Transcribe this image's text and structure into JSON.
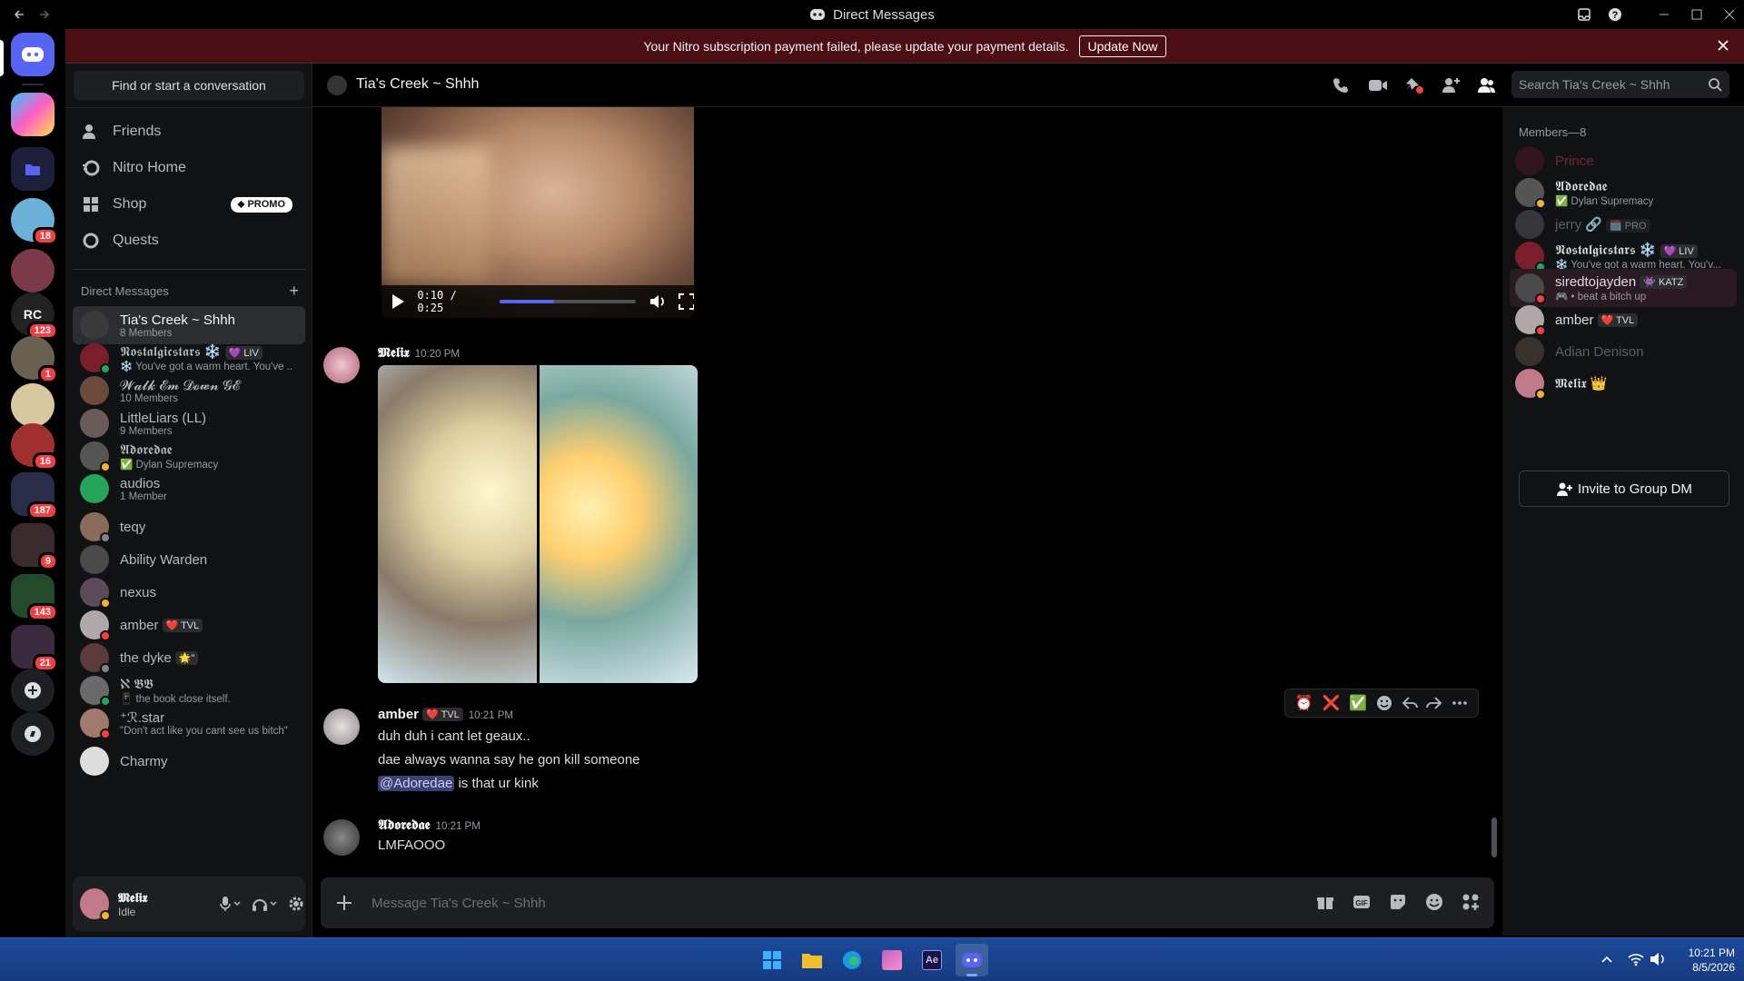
{
  "window": {
    "title": "Direct Messages"
  },
  "banner": {
    "text": "Your Nitro subscription payment failed, please update your payment details.",
    "button": "Update Now"
  },
  "rail": {
    "badges": [
      "18",
      "123",
      "1",
      "16",
      "187",
      "9",
      "143",
      "21"
    ],
    "logo_text": "RC"
  },
  "sidebar": {
    "find_placeholder": "Find or start a conversation",
    "nav": [
      {
        "label": "Friends",
        "icon": "friends-icon"
      },
      {
        "label": "Nitro Home",
        "icon": "nitro-icon"
      },
      {
        "label": "Shop",
        "icon": "shop-icon",
        "badge": "PROMO"
      },
      {
        "label": "Quests",
        "icon": "quests-icon"
      }
    ],
    "dm_header": "Direct Messages",
    "dms": [
      {
        "name": "Tia's Creek ~ Shhh",
        "sub": "8 Members",
        "color": "#3a3a3a",
        "status": ""
      },
      {
        "name": "𝕹𝖔𝖘𝖙𝖆𝖑𝖌𝖎𝖈𝖘𝖙𝖆𝖗𝖘 ❄️",
        "tag": "💜 LIV",
        "sub": "❄️ You've got a warm heart. You've ...",
        "color": "#7a1e2a",
        "status": "#23a55a"
      },
      {
        "name": "𝓦𝓪𝓵𝓴 𝓔𝓶 𝓓𝓸𝔀𝓷 𝓖𝓔",
        "sub": "10 Members",
        "color": "#6b4a3a",
        "status": ""
      },
      {
        "name": "LittleLiars (LL)",
        "sub": "9 Members",
        "color": "#6a5a5a",
        "status": ""
      },
      {
        "name": "𝕬𝖉𝖔𝖗𝖊𝖉𝖆𝖊",
        "sub": "✅ Dylan Supremacy",
        "color": "#555",
        "status": "#f0b232"
      },
      {
        "name": "audios",
        "sub": "1 Member",
        "color": "#23a55a",
        "status": ""
      },
      {
        "name": "teqy",
        "sub": "",
        "color": "#8a6a5a",
        "status": "#80848e"
      },
      {
        "name": "Ability Warden",
        "sub": "",
        "color": "#4a4a4a",
        "status": ""
      },
      {
        "name": "nexus",
        "sub": "",
        "color": "#5a4a5a",
        "status": "#f0b232"
      },
      {
        "name": "amber",
        "tag": "❤️ TVL",
        "sub": "",
        "color": "#b0a8a8",
        "status": "#f23f43"
      },
      {
        "name": "the dyke",
        "tag": "🌟\"",
        "sub": "",
        "color": "#5a3a3a",
        "status": "#80848e"
      },
      {
        "name": "ℵ 𝕭𝕭",
        "sub": "📱 the book close itself.",
        "color": "#6a6a6a",
        "status": "#23a55a"
      },
      {
        "name": "⁺ℛ.star",
        "sub": "\"Don't act like you cant see us bitch\"",
        "color": "#a07a6a",
        "status": "#f23f43"
      },
      {
        "name": "Charmy",
        "sub": "",
        "color": "#ddd",
        "status": ""
      }
    ]
  },
  "user": {
    "name": "𝕸𝖊𝖑𝖎𝖝",
    "status": "Idle"
  },
  "channel": {
    "name": "Tia's Creek ~ Shhh",
    "search_placeholder": "Search Tia's Creek ~ Shhh"
  },
  "video": {
    "time": "0:10 / 0:25",
    "progress": 0.4
  },
  "messages": [
    {
      "author": "𝕸𝖊𝖑𝖎𝖝",
      "time": "10:20 PM",
      "lines": []
    },
    {
      "author": "amber",
      "tag": "❤️ TVL",
      "time": "10:21 PM",
      "lines": [
        "duh duh i cant let geaux..",
        "dae always wanna say he gon kill someone"
      ],
      "mention": "@Adoredae",
      "mention_rest": " is that ur kink"
    },
    {
      "author": "𝕬𝖉𝖔𝖗𝖊𝖉𝖆𝖊",
      "time": "10:21 PM",
      "lines": [
        "LMFAOOO"
      ]
    }
  ],
  "composer": {
    "placeholder": "Message Tia's Creek ~ Shhh"
  },
  "members_panel": {
    "header": "Members—8",
    "members": [
      {
        "name": "Prince",
        "sub": "",
        "color": "#5c1a2a",
        "dim": true,
        "status": ""
      },
      {
        "name": "𝕬𝖉𝖔𝖗𝖊𝖉𝖆𝖊",
        "sub": "✅ Dylan Supremacy",
        "color": "#555",
        "dim": false,
        "status": "#f0b232"
      },
      {
        "name": "jerry 🔗",
        "tag": "🗓️ PRO",
        "sub": "",
        "color": "#666",
        "dim": true,
        "status": ""
      },
      {
        "name": "𝕹𝖔𝖘𝖙𝖆𝖑𝖌𝖎𝖈𝖘𝖙𝖆𝖗𝖘 ❄️",
        "tag": "💜 LIV",
        "sub": "❄️ You've got a warm heart. You'v...",
        "color": "#7a1e2a",
        "dim": false,
        "status": "#23a55a"
      },
      {
        "name": "siredtojayden",
        "tag": "👾 KATZ",
        "sub": "🎮 • beat a bitch up",
        "color": "#4a4a4a",
        "dim": false,
        "status": "#f23f43"
      },
      {
        "name": "amber",
        "tag": "❤️ TVL",
        "sub": "",
        "color": "#b0a8a8",
        "dim": false,
        "status": "#f23f43"
      },
      {
        "name": "Adian Denison",
        "sub": "",
        "color": "#6a5a4a",
        "dim": true,
        "status": ""
      },
      {
        "name": "𝕸𝖊𝖑𝖎𝖝 👑",
        "sub": "",
        "color": "#c07a8a",
        "dim": false,
        "status": "#f0b232"
      }
    ],
    "invite_button": "Invite to Group DM"
  },
  "message_actions": [
    "⏰",
    "❌",
    "✅"
  ],
  "taskbar": {
    "time": "10:21 PM",
    "date": "8/5/2026"
  },
  "colors": {
    "accent": "#5865f2",
    "danger": "#f23f43",
    "online": "#23a55a",
    "idle": "#f0b232",
    "banner": "#4b0e12"
  }
}
